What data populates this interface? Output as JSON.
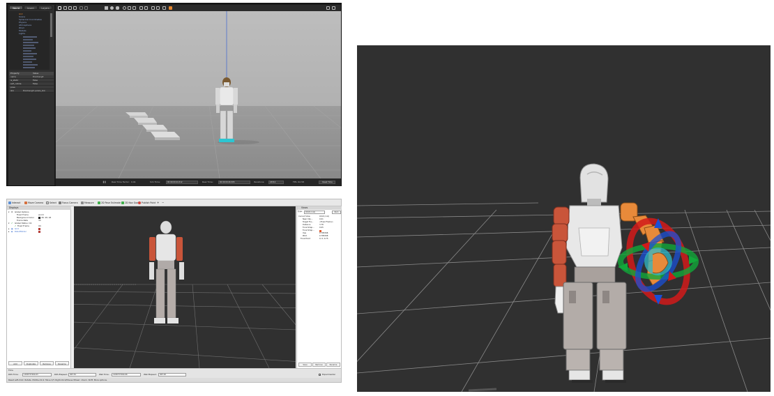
{
  "gazebo": {
    "tabs": [
      "World",
      "Insert",
      "Layers"
    ],
    "tree": {
      "selected": "GUI",
      "items": [
        "Scene",
        "Spherical Coordinates",
        "Physics",
        "Atmosphere",
        "Wind",
        "Models",
        "Lights"
      ]
    },
    "properties": {
      "header_property": "Property",
      "header_value": "Value",
      "rows": [
        {
          "name": "name",
          "value": "thormang3"
        },
        {
          "name": "is_static",
          "value": "False"
        },
        {
          "name": "self_collide",
          "value": "False"
        },
        {
          "name": "pose",
          "value": ""
        },
        {
          "name": "link",
          "value": "thormang3::pelvis_link"
        }
      ]
    },
    "status": {
      "real_time_factor_label": "Real Time Factor:",
      "real_time_factor": "0.91",
      "sim_time_label": "Sim Time:",
      "sim_time": "00 00:00:24.312",
      "real_time_label": "Real Time:",
      "real_time": "00 00:00:26.505",
      "iterations_label": "Iterations:",
      "iterations": "24312",
      "fps": "FPS: 62.58",
      "reset_label": "Reset Time"
    }
  },
  "rviz": {
    "toolbar": [
      {
        "label": "Interact",
        "icon": "interact-icon",
        "color": "#5a8fd6"
      },
      {
        "label": "Move Camera",
        "icon": "move-camera-icon",
        "color": "#d66f3c"
      },
      {
        "label": "Select",
        "icon": "select-icon",
        "color": "#cccccc"
      },
      {
        "label": "Focus Camera",
        "icon": "focus-camera-icon",
        "color": "#7a7a7a"
      },
      {
        "label": "Measure",
        "icon": "measure-icon",
        "color": "#8a8a8a"
      },
      {
        "label": "2D Pose Estimate",
        "icon": "pose-estimate-icon",
        "color": "#3fae4a"
      },
      {
        "label": "2D Nav Goal",
        "icon": "nav-goal-icon",
        "color": "#3fae4a"
      },
      {
        "label": "Publish Point",
        "icon": "publish-point-icon",
        "color": "#d6453c"
      }
    ],
    "displays": {
      "title": "Displays",
      "rows": [
        {
          "key": "Global Options",
          "value": ""
        },
        {
          "key": "Fixed Frame",
          "value": "world"
        },
        {
          "key": "Background Color",
          "value": "48; 48; 48"
        },
        {
          "key": "Frame Rate",
          "value": "30"
        },
        {
          "key": "Global Status: Ok",
          "value": ""
        },
        {
          "key": "Fixed Frame",
          "value": "OK"
        },
        {
          "key": "Grid",
          "value": ""
        },
        {
          "key": "RobotModel",
          "value": ""
        }
      ],
      "buttons": [
        "Add",
        "Duplicate",
        "Remove",
        "Rename"
      ]
    },
    "views": {
      "title": "Views",
      "type_label": "Type:",
      "type_value": "Orbit (rviz)",
      "zero_label": "Zero",
      "rows": [
        {
          "key": "Current View",
          "value": "Orbit (rviz)"
        },
        {
          "key": "Near Clip...",
          "value": "0.01"
        },
        {
          "key": "Target Fra...",
          "value": "<Fixed Frame>"
        },
        {
          "key": "Distance",
          "value": "3.78"
        },
        {
          "key": "Focal Shap...",
          "value": "0.05"
        },
        {
          "key": "Focal Shap...",
          "value": ""
        },
        {
          "key": "Yaw",
          "value": "0.785398"
        },
        {
          "key": "Pitch",
          "value": "0.785398"
        },
        {
          "key": "Focal Point",
          "value": "0; 0; 0.75"
        }
      ],
      "buttons": [
        "Save",
        "Remove",
        "Rename"
      ]
    },
    "time": {
      "title": "Time",
      "ros_time_label": "ROS Time:",
      "ros_time": "1496737464.63",
      "ros_elapsed_label": "ROS Elapsed:",
      "ros_elapsed": "403.52",
      "wall_time_label": "Wall Time:",
      "wall_time": "1496737464.66",
      "wall_elapsed_label": "Wall Elapsed:",
      "wall_elapsed": "403.20",
      "experimental_label": "Experimental"
    },
    "hint": "Reset   Left-Click: Rotate.  Middle-Click: Move X/Y.  Right-Click/Mouse Wheel:: Zoom.  Shift: More options."
  },
  "colors": {
    "gazebo_background": "#1b1b1b",
    "rviz_background": "#303030",
    "grid_line": "#8a8a8a",
    "orange_link": "#e88a3a",
    "red_link": "#c9553a",
    "marker_red": "#d11a1a",
    "marker_green": "#12a83a",
    "marker_blue": "#1a4fd6"
  }
}
